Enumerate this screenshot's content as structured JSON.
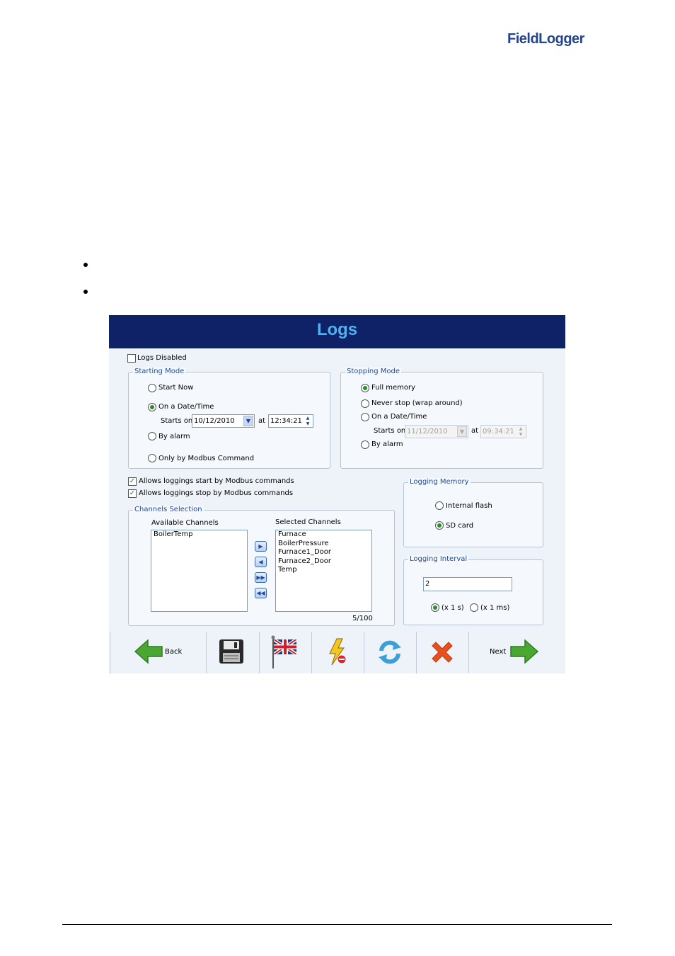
{
  "brand": {
    "logo_text": "FieldLogger"
  },
  "window": {
    "title": "Logs"
  },
  "logs_disabled": {
    "label": "Logs Disabled",
    "checked": false
  },
  "starting_mode": {
    "legend": "Starting Mode",
    "start_now": "Start Now",
    "on_date_time": "On a Date/Time",
    "starts_on_label": "Starts on",
    "date": "10/12/2010",
    "at_label": "at",
    "time": "12:34:21",
    "by_alarm": "By alarm",
    "only_modbus": "Only by Modbus Command",
    "selected": "on_date_time"
  },
  "stopping_mode": {
    "legend": "Stopping Mode",
    "full_memory": "Full memory",
    "never_stop": "Never stop (wrap around)",
    "on_date_time": "On a Date/Time",
    "starts_on_label": "Starts on",
    "date": "11/12/2010",
    "at_label": "at",
    "time": "09:34:21",
    "by_alarm": "By alarm",
    "selected": "full_memory"
  },
  "modbus": {
    "allow_start": "Allows loggings start by Modbus commands",
    "allow_stop": "Allows loggings stop by Modbus commands"
  },
  "channels": {
    "legend": "Channels Selection",
    "available_label": "Available Channels",
    "selected_label": "Selected Channels",
    "available": [
      "BoilerTemp"
    ],
    "selected": [
      "Furnace",
      "BoilerPressure",
      "Furnace1_Door",
      "Furnace2_Door",
      "Temp"
    ],
    "count": "5/100"
  },
  "logging_memory": {
    "legend": "Logging Memory",
    "internal_flash": "Internal flash",
    "sd_card": "SD card",
    "selected": "sd_card"
  },
  "logging_interval": {
    "legend": "Logging Interval",
    "value": "2",
    "unit_s": "(x 1 s)",
    "unit_ms": "(x 1 ms)",
    "selected": "s"
  },
  "toolbar": {
    "back_label": "Back",
    "next_label": "Next",
    "icons": [
      "back-arrow-icon",
      "floppy-disk-icon",
      "uk-flag-icon",
      "lightning-icon",
      "refresh-icon",
      "close-x-icon",
      "next-arrow-icon"
    ]
  },
  "colors": {
    "title_bg": "#0f2167",
    "title_text": "#4fb3f0",
    "panel_bg": "#eef3fa",
    "legend_text": "#1e4c9a",
    "arrow_green": "#4aa832",
    "close_orange": "#e8501e"
  }
}
